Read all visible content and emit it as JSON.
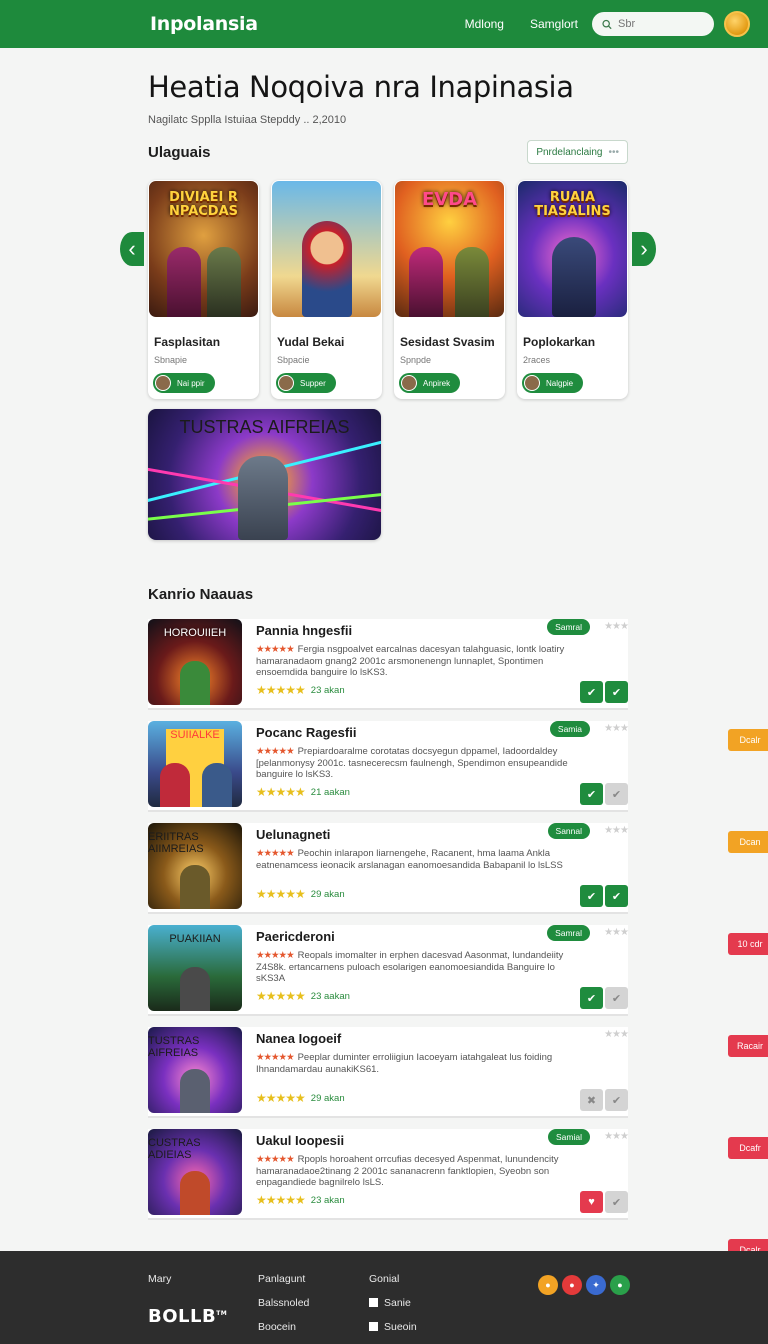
{
  "header": {
    "brand": "Inpolansia",
    "nav": [
      "Mdlong",
      "Samglort"
    ],
    "search_placeholder": "Sbr"
  },
  "page": {
    "title": "Heatia Noqoiva nra Inapinasia",
    "subtitle": "Nagilatc Spplla Istuiaa Stepddy .. 2,2010"
  },
  "featured": {
    "title": "Ulaguais",
    "sort_label": "Pnrdelanclaing",
    "cards": [
      {
        "art_text": "DIVIAEI R NPACDAS",
        "title": "Fasplasitan",
        "sub": "Sbnapie",
        "pill": "Nai ppir"
      },
      {
        "art_text": "",
        "title": "Yudal Bekai",
        "sub": "Sbpacie",
        "pill": "Supper"
      },
      {
        "art_text": "EVDA",
        "title": "Sesidast Svasim",
        "sub": "Spnpde",
        "pill": "Anpirek"
      },
      {
        "art_text": "RUAIA TIASALINS",
        "title": "Poplokarkan",
        "sub": "2races",
        "pill": "Nalgpie"
      }
    ],
    "banner_text": "TUSTRAS AIFREIAS"
  },
  "list": {
    "title": "Kanrio Naauas",
    "items": [
      {
        "art_text": "HOROUIIEH",
        "title": "Pannia hngesfii",
        "tag": "Samral",
        "desc": "Fergia nsgpoalvet earcalnas dacesyan talahguasic, lontk loatiry hamaranadaom gnang2 2001c arsmonenengn lunnaplet, Spontimen ensoemdida banguire lo lsKS3.",
        "rating": "23 akan",
        "action": "Dcalr",
        "btn1": "✔",
        "btn2": "✔"
      },
      {
        "art_text": "SUIIALKE",
        "title": "Pocanc Ragesfii",
        "tag": "Samia",
        "desc": "Prepiardoaralme corotatas docsyegun dppamel, Iadoordaldey [pelanmonysy 2001c. tasnecerecsm faulnengh, Spendimon ensupeandide banguire lo lsKS3.",
        "rating": "21 aakan",
        "action": "Dcan",
        "btn1": "✔",
        "btn2": "✔"
      },
      {
        "art_text": "ERIITRAS AIIMREIAS",
        "title": "Uelunagneti",
        "tag": "Sannal",
        "desc": "Peochin inlarapon liarnengehe, Racanent, hma laama Ankla eatnenamcess ieonacik arslanagan eanomoesandida Babapanil lo lsLSS",
        "rating": "29 akan",
        "action": "10 cdr",
        "btn1": "✔",
        "btn2": "✔"
      },
      {
        "art_text": "PUAKIIAN",
        "title": "Paericderoni",
        "tag": "Samral",
        "desc": "Reopals imomalter in erphen dacesvad Aasonmat, lundandeiity Z4S8k. ertancarnens puloach esolarigen eanomoesiandida Banguire lo sKS3A",
        "rating": "23 aakan",
        "action": "Racair",
        "btn1": "✔",
        "btn2": "✔"
      },
      {
        "art_text": "TUSTRAS AIFREIAS",
        "title": "Nanea Iogoeif",
        "tag": "",
        "desc": "Peeplar duminter erroliigiun Iacoeyam iatahgaleat lus foiding Ihnandamardau aunakiKS61.",
        "rating": "29 akan",
        "action": "Dcafr",
        "btn1": "✖",
        "btn2": "✔"
      },
      {
        "art_text": "CUSTRAS ADIEIAS",
        "title": "Uakul Ioopesii",
        "tag": "Samial",
        "desc": "Rpopls horoahent orrcufias decesyed Aspenmat, lunundencity hamaranadaoe2tinang 2 2001c sananacrenn fanktlopien, Syeobn son enpagandiede bagnilrelo lsLS.",
        "rating": "23 akan",
        "action": "Dcalr",
        "btn1": "♥",
        "btn2": "✔"
      }
    ]
  },
  "footer": {
    "logo": "BOLLB",
    "logo_mark": "TM",
    "col1": [
      "Mary"
    ],
    "col2": [
      "Panlagunt",
      "Balssnoled",
      "Boocein"
    ],
    "col3": [
      "Gonial",
      "Sanie",
      "Sueoin"
    ]
  },
  "colors": {
    "brand_green": "#1e8a3c",
    "footer_bg": "#2d2d2d",
    "danger": "#e43a4e",
    "warning": "#f2a324"
  }
}
